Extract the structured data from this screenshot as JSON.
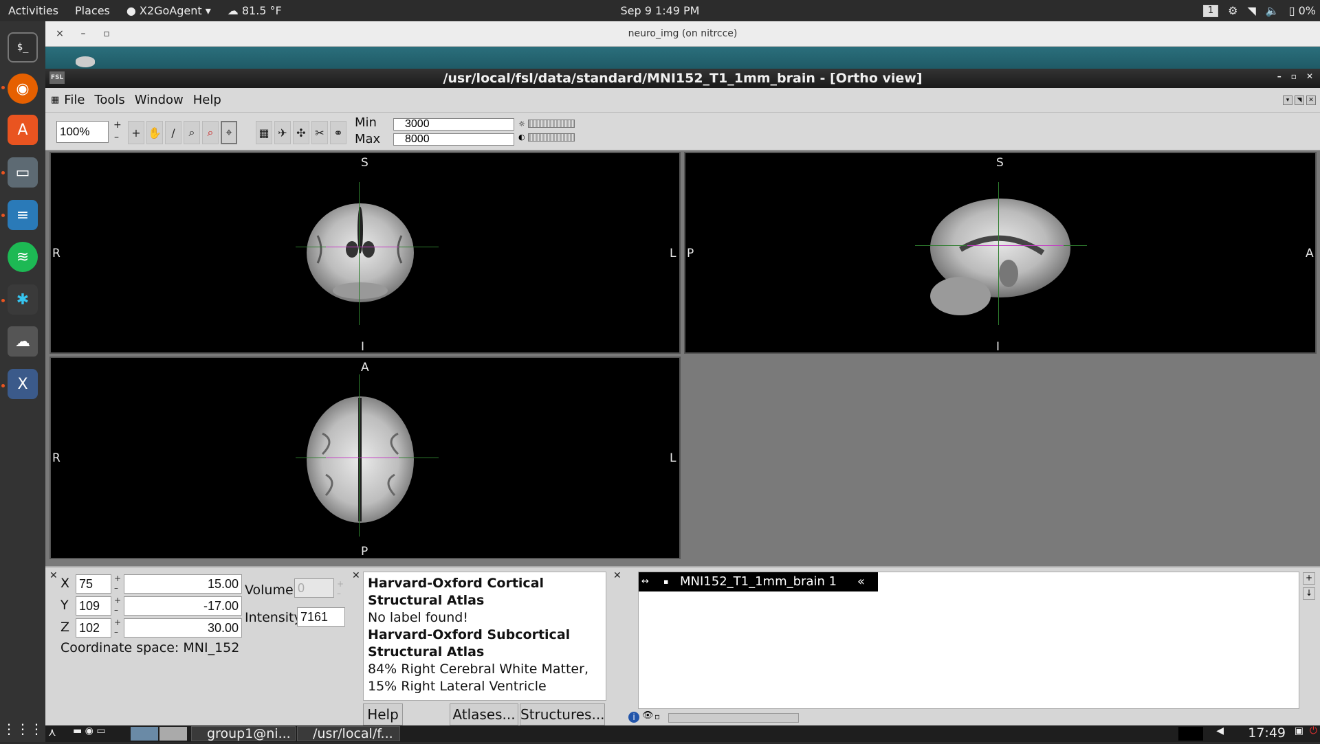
{
  "topbar": {
    "activities": "Activities",
    "places": "Places",
    "app": "X2GoAgent",
    "weather": "81.5 °F",
    "clock": "Sep 9  1:49 PM",
    "workspace": "1",
    "battery": "0%"
  },
  "dock": {
    "icons": [
      "terminal-icon",
      "firefox-icon",
      "software-center-icon",
      "files-icon",
      "writer-icon",
      "spotify-icon",
      "slack-icon",
      "x2go-icon",
      "xming-icon",
      "app-grid-icon"
    ]
  },
  "x2go_window": {
    "title": "neuro_img (on nitrcce)",
    "close": "×",
    "minimize": "–",
    "maximize": "▫"
  },
  "fsl_window": {
    "title": "/usr/local/fsl/data/standard/MNI152_T1_1mm_brain - [Ortho view]",
    "icon_text": "FSL"
  },
  "menu": {
    "file": "File",
    "tools": "Tools",
    "window": "Window",
    "help": "Help"
  },
  "toolbar": {
    "zoom": "100%",
    "min_label": "Min",
    "min_value": "3000",
    "max_label": "Max",
    "max_value": "8000"
  },
  "views": {
    "coronal": {
      "top": "S",
      "bottom": "I",
      "left": "R",
      "right": "L"
    },
    "sagittal": {
      "top": "S",
      "bottom": "I",
      "left": "P",
      "right": "A"
    },
    "axial": {
      "top": "A",
      "bottom": "P",
      "left": "R",
      "right": "L"
    }
  },
  "cursor": {
    "x_label": "X",
    "x_vox": "75",
    "x_world": "15.00",
    "y_label": "Y",
    "y_vox": "109",
    "y_world": "-17.00",
    "z_label": "Z",
    "z_vox": "102",
    "z_world": "30.00",
    "volume_label": "Volume",
    "volume_value": "0",
    "intensity_label": "Intensity",
    "intensity_value": "7161",
    "coord_space": "Coordinate space: MNI_152"
  },
  "atlas": {
    "cortical_title": "Harvard-Oxford Cortical Structural Atlas",
    "cortical_result": "No label found!",
    "subcortical_title": "Harvard-Oxford Subcortical Structural Atlas",
    "subcortical_result": "84% Right Cerebral White Matter, 15% Right Lateral Ventricle",
    "help_btn": "Help",
    "atlases_btn": "Atlases...",
    "structures_btn": "Structures..."
  },
  "layers": {
    "name": "MNI152_T1_1mm_brain 1"
  },
  "taskbar": {
    "task1": "group1@ni...",
    "task2": "/usr/local/f...",
    "time": "17:49"
  }
}
